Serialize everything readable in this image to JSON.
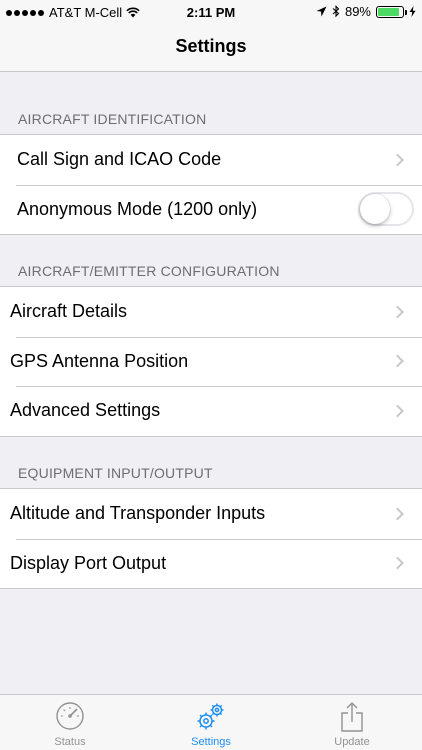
{
  "status_bar": {
    "carrier": "AT&T M-Cell",
    "time": "2:11 PM",
    "battery_percent": "89%",
    "battery_level": 0.89
  },
  "nav": {
    "title": "Settings"
  },
  "sections": [
    {
      "header": "AIRCRAFT IDENTIFICATION",
      "rows": [
        {
          "label": "Call Sign and ICAO Code",
          "accessory": "chevron"
        },
        {
          "label": "Anonymous Mode (1200 only)",
          "accessory": "toggle",
          "toggle_on": false
        }
      ]
    },
    {
      "header": "AIRCRAFT/EMITTER CONFIGURATION",
      "rows": [
        {
          "label": "Aircraft Details",
          "accessory": "chevron"
        },
        {
          "label": "GPS Antenna Position",
          "accessory": "chevron"
        },
        {
          "label": "Advanced Settings",
          "accessory": "chevron"
        }
      ]
    },
    {
      "header": "EQUIPMENT INPUT/OUTPUT",
      "rows": [
        {
          "label": "Altitude and Transponder Inputs",
          "accessory": "chevron"
        },
        {
          "label": "Display Port Output",
          "accessory": "chevron"
        }
      ]
    }
  ],
  "tabs": [
    {
      "label": "Status",
      "icon": "gauge-icon",
      "active": false
    },
    {
      "label": "Settings",
      "icon": "gears-icon",
      "active": true
    },
    {
      "label": "Update",
      "icon": "share-upload-icon",
      "active": false
    }
  ],
  "colors": {
    "accent": "#1f8ef1",
    "battery": "#4cd964",
    "background": "#efeff4"
  }
}
